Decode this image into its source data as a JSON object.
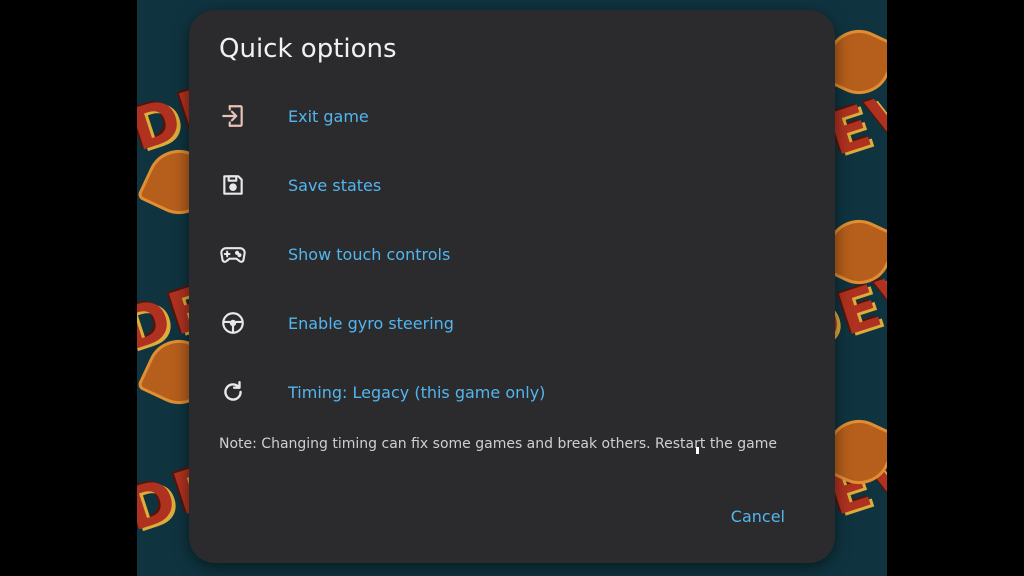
{
  "dialog": {
    "title": "Quick options",
    "options": [
      {
        "label": "Exit game",
        "icon": "exit-icon"
      },
      {
        "label": "Save states",
        "icon": "save-icon"
      },
      {
        "label": "Show touch controls",
        "icon": "gamepad-icon"
      },
      {
        "label": "Enable gyro steering",
        "icon": "steering-wheel-icon"
      },
      {
        "label": "Timing: Legacy (this game only)",
        "icon": "refresh-icon"
      }
    ],
    "note": "Note: Changing timing can fix some games and break others. Restart the game",
    "cancel_label": "Cancel"
  },
  "colors": {
    "dialog_bg": "#2b2b2e",
    "accent": "#52b6ee",
    "title_text": "#f1f1f1",
    "background": "#0f3440"
  }
}
